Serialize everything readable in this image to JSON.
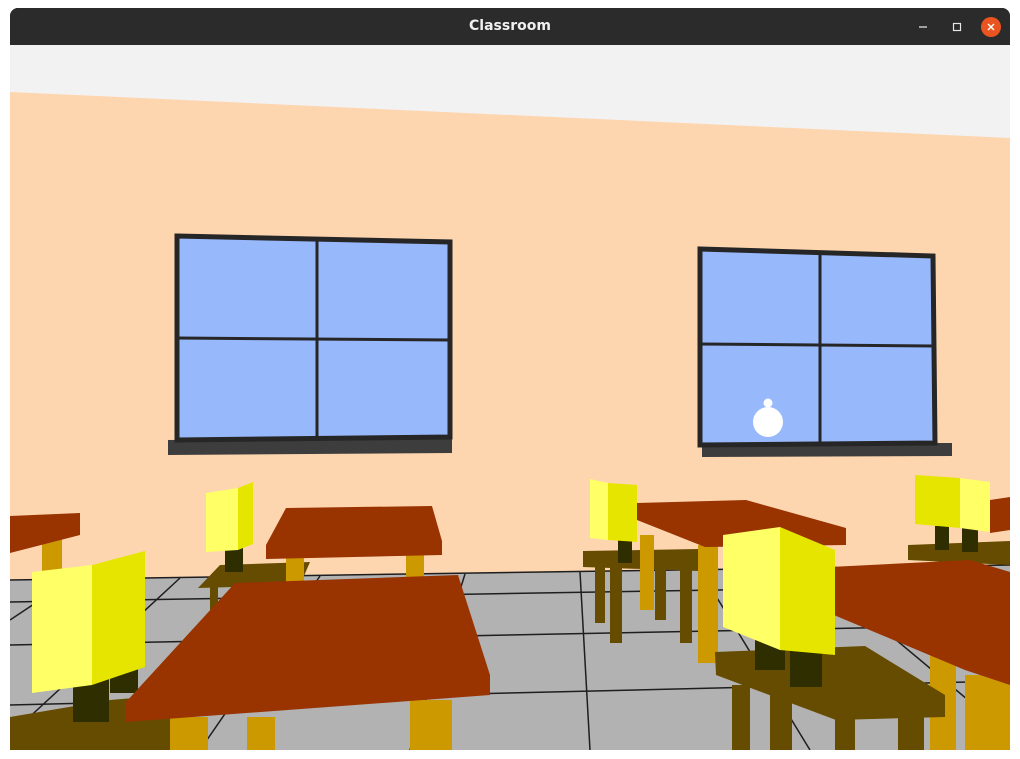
{
  "window": {
    "title": "Classroom"
  },
  "scene": {
    "name": "classroom-3d-view",
    "colors": {
      "ceiling": "#f2f2f2",
      "wall": "#fdd6b0",
      "floor": "#b2b2b2",
      "floor_lines": "#1e1e1e",
      "window_glass": "#98b8fc",
      "window_frame": "#262626",
      "window_sill": "#3d3d3d",
      "desk_top": "#993300",
      "desk_leg": "#cc9900",
      "chair": "#664c00",
      "chair_post": "#2e2e00",
      "backrest_front": "#ffff66",
      "backrest_side": "#e5e500",
      "ball": "#ffffff"
    }
  }
}
